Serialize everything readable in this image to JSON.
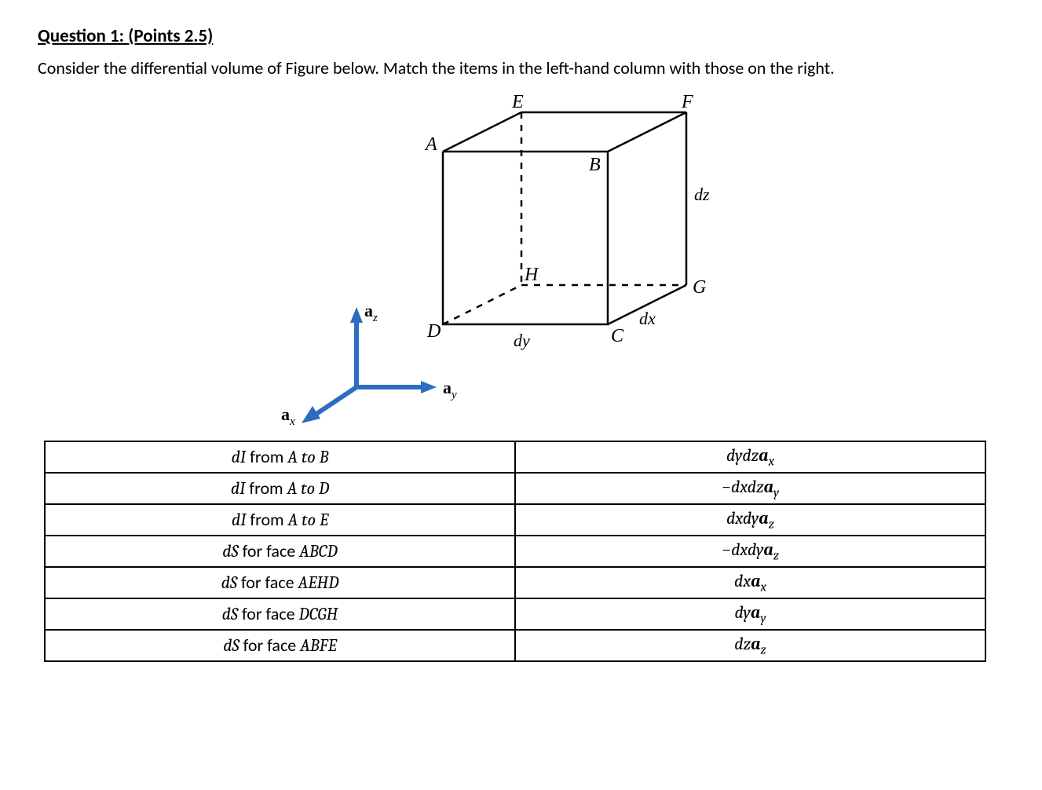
{
  "question": {
    "title": "Question 1: (Points 2.5)",
    "body": "Consider the differential volume of Figure below. Match the items in the left-hand column with those on the right."
  },
  "figure": {
    "vertices": {
      "A": "A",
      "B": "B",
      "C": "C",
      "D": "D",
      "E": "E",
      "F": "F",
      "G": "G",
      "H": "H"
    },
    "edges": {
      "dx": "dx",
      "dy": "dy",
      "dz": "dz"
    },
    "axes": {
      "ax": "a",
      "ax_sub": "x",
      "ay": "a",
      "ay_sub": "y",
      "az": "a",
      "az_sub": "z"
    }
  },
  "table": {
    "left": [
      {
        "pre": "dI",
        "mid": " from ",
        "post": "A to B"
      },
      {
        "pre": "dI",
        "mid": " from ",
        "post": "A to D"
      },
      {
        "pre": "dI",
        "mid": " from ",
        "post": "A to E"
      },
      {
        "pre": "dS",
        "mid": " for face ",
        "post": "ABCD"
      },
      {
        "pre": "dS",
        "mid": " for face ",
        "post": "AEHD"
      },
      {
        "pre": "dS",
        "mid": " for face ",
        "post": "DCGH"
      },
      {
        "pre": "dS",
        "mid": " for face ",
        "post": "ABFE"
      }
    ],
    "right": [
      {
        "diff": "dydz",
        "vec": "a",
        "sub": "x",
        "neg": ""
      },
      {
        "diff": "dxdz",
        "vec": "a",
        "sub": "y",
        "neg": "−"
      },
      {
        "diff": "dxdy",
        "vec": "a",
        "sub": "z",
        "neg": ""
      },
      {
        "diff": "dxdy",
        "vec": "a",
        "sub": "z",
        "neg": "−"
      },
      {
        "diff": "dx",
        "vec": "a",
        "sub": "x",
        "neg": ""
      },
      {
        "diff": "dy",
        "vec": "a",
        "sub": "y",
        "neg": ""
      },
      {
        "diff": "dz",
        "vec": "a",
        "sub": "z",
        "neg": ""
      }
    ]
  }
}
